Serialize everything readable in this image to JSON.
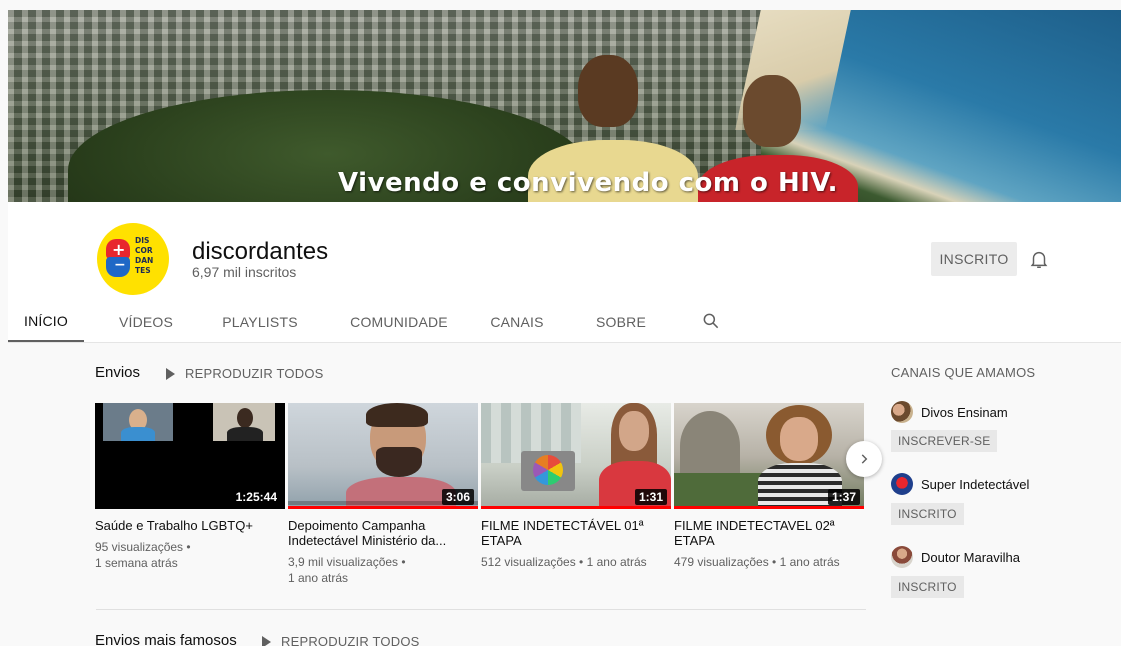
{
  "banner": {
    "tagline": "Vivendo e convivendo com o HIV."
  },
  "channel": {
    "name": "discordantes",
    "subscribers": "6,97 mil inscritos",
    "logo_text": [
      "DIS",
      "COR",
      "DAN",
      "TES"
    ],
    "subscribe_label": "INSCRITO",
    "brand_color": "#ffe100"
  },
  "tabs": [
    {
      "label": "INÍCIO",
      "active": true
    },
    {
      "label": "VÍDEOS",
      "active": false
    },
    {
      "label": "PLAYLISTS",
      "active": false
    },
    {
      "label": "COMUNIDADE",
      "active": false
    },
    {
      "label": "CANAIS",
      "active": false
    },
    {
      "label": "SOBRE",
      "active": false
    }
  ],
  "uploads": {
    "title": "Envios",
    "play_all": "REPRODUZIR TODOS",
    "videos": [
      {
        "title": "Saúde e Trabalho LGBTQ+",
        "duration": "1:25:44",
        "meta1": "95 visualizações •",
        "meta2": "1 semana atrás",
        "thumb": "video-call"
      },
      {
        "title": "Depoimento Campanha Indetectável Ministério da...",
        "duration": "3:06",
        "meta1": "3,9 mil visualizações •",
        "meta2": "1 ano atrás",
        "thumb": "bearded-man"
      },
      {
        "title": "FILME INDETECTÁVEL 01ª ETAPA",
        "duration": "1:31",
        "meta1": "512 visualizações • 1 ano atrás",
        "meta2": "",
        "thumb": "woman-laptop"
      },
      {
        "title": "FILME INDETECTAVEL 02ª ETAPA",
        "duration": "1:37",
        "meta1": "479 visualizações • 1 ano atrás",
        "meta2": "",
        "thumb": "woman-striped"
      }
    ]
  },
  "popular": {
    "title": "Envios mais famosos",
    "play_all": "REPRODUZIR TODOS"
  },
  "sidebar": {
    "title": "CANAIS QUE AMAMOS",
    "channels": [
      {
        "name": "Divos Ensinam",
        "button": "INSCREVER-SE"
      },
      {
        "name": "Super Indetectável",
        "button": "INSCRITO"
      },
      {
        "name": "Doutor Maravilha",
        "button": "INSCRITO"
      }
    ]
  }
}
